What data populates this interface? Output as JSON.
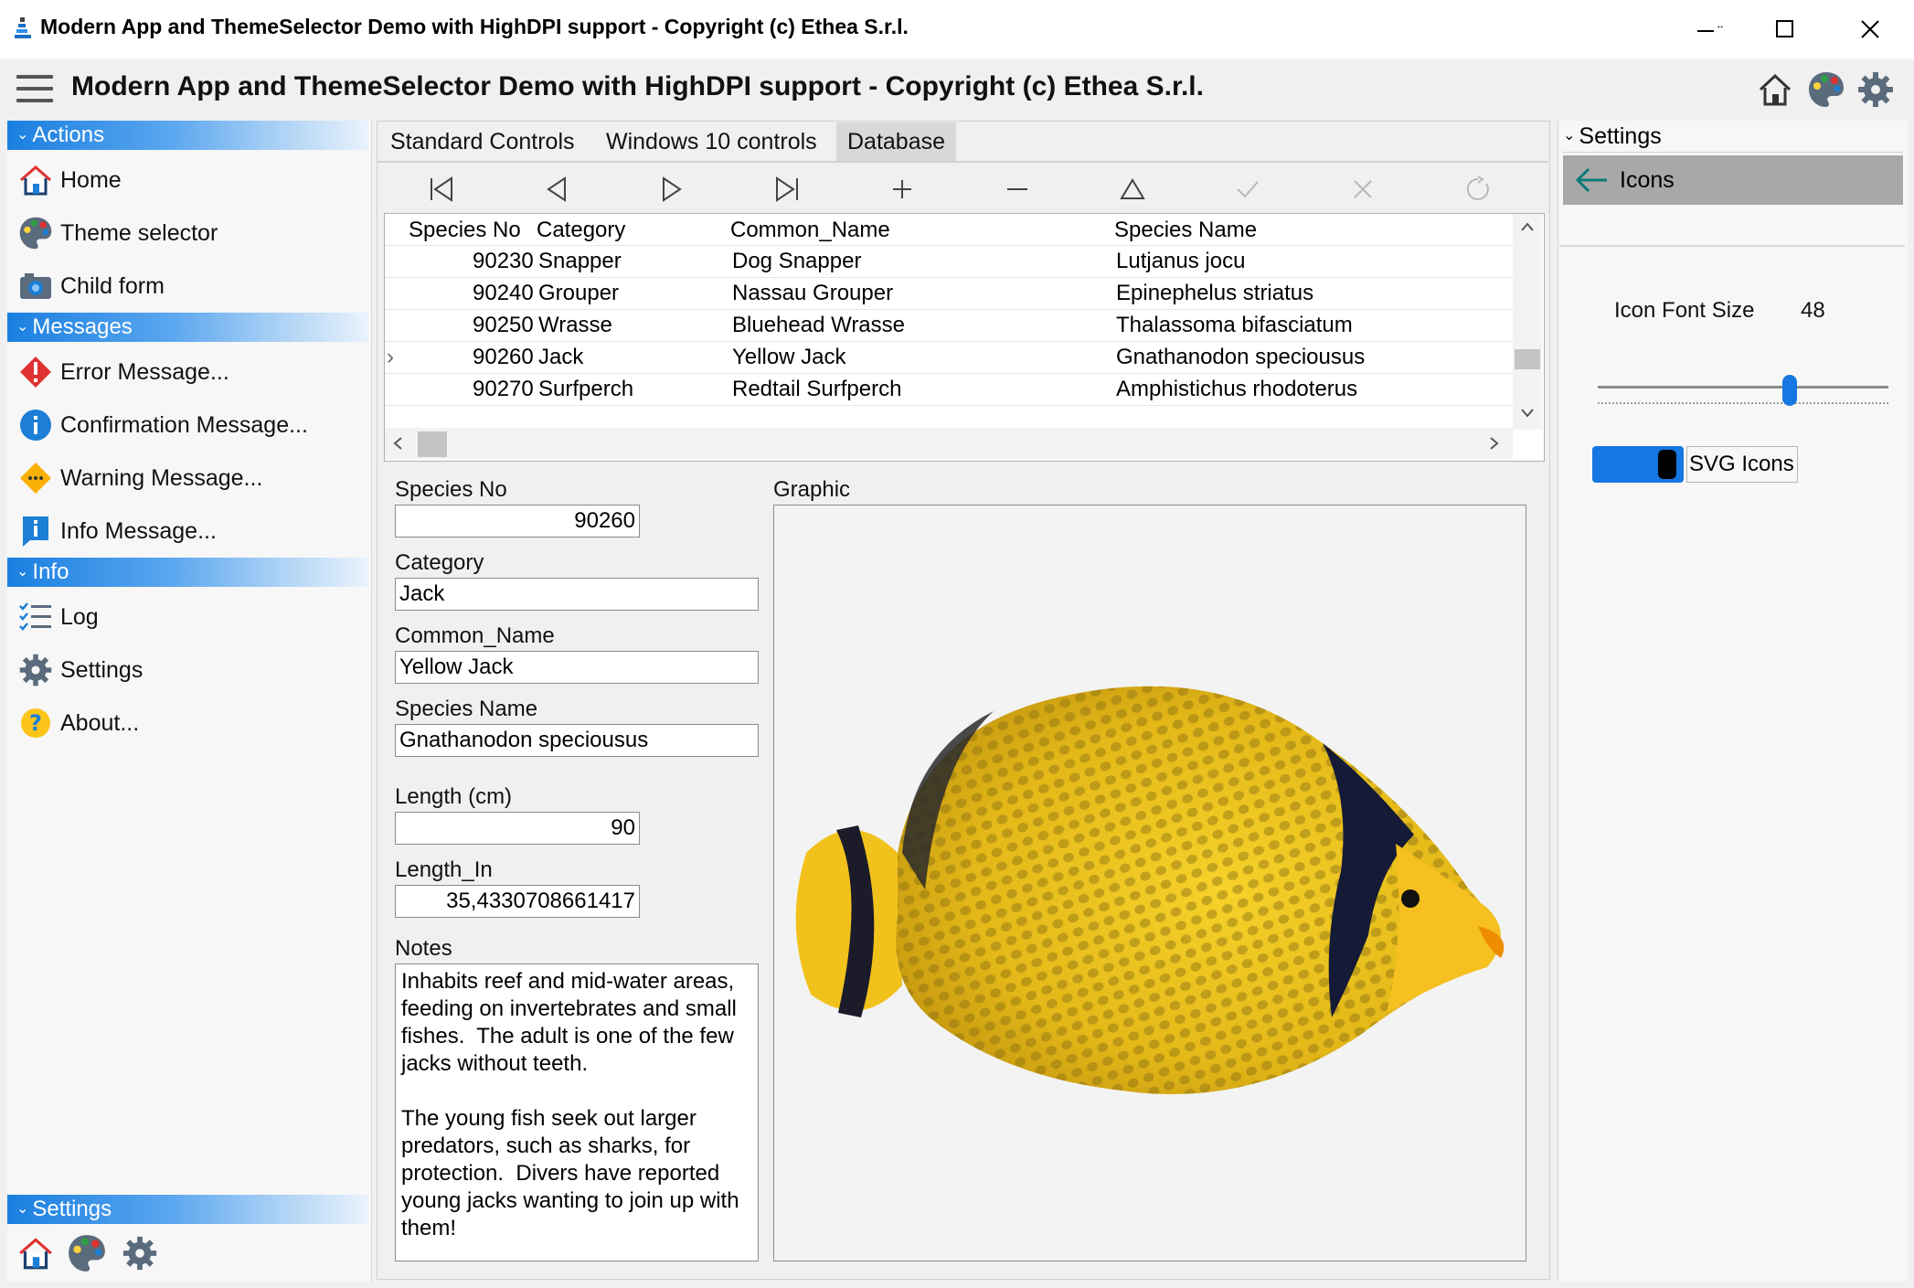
{
  "window": {
    "title": "Modern App and ThemeSelector Demo with HighDPI support - Copyright (c) Ethea S.r.l.",
    "controls": {
      "minimize": "—",
      "maximize": "☐",
      "close": "✕"
    }
  },
  "header": {
    "title": "Modern App and ThemeSelector Demo with HighDPI support - Copyright (c) Ethea S.r.l.",
    "icons": [
      "home-icon",
      "palette-icon",
      "gear-icon"
    ]
  },
  "left_panel": {
    "groups": [
      {
        "title": "Actions",
        "items": [
          {
            "label": "Home",
            "icon": "home-icon"
          },
          {
            "label": "Theme selector",
            "icon": "palette-icon"
          },
          {
            "label": "Child form",
            "icon": "camera-icon"
          }
        ]
      },
      {
        "title": "Messages",
        "items": [
          {
            "label": "Error Message...",
            "icon": "error-icon"
          },
          {
            "label": "Confirmation Message...",
            "icon": "info-circle-icon"
          },
          {
            "label": "Warning Message...",
            "icon": "warning-icon"
          },
          {
            "label": "Info Message...",
            "icon": "info-bubble-icon"
          }
        ]
      },
      {
        "title": "Info",
        "items": [
          {
            "label": "Log",
            "icon": "checklist-icon"
          },
          {
            "label": "Settings",
            "icon": "gear-icon"
          },
          {
            "label": "About...",
            "icon": "question-icon"
          }
        ]
      },
      {
        "title": "Settings",
        "items": []
      }
    ],
    "bottom_icons": [
      "home-icon",
      "palette-icon",
      "gear-icon"
    ]
  },
  "tabs": [
    {
      "label": "Standard Controls",
      "active": false
    },
    {
      "label": "Windows 10 controls",
      "active": false
    },
    {
      "label": "Database",
      "active": true
    }
  ],
  "navigator": {
    "buttons": [
      {
        "name": "first",
        "glyph": "|◁"
      },
      {
        "name": "prior",
        "glyph": "◁"
      },
      {
        "name": "next",
        "glyph": "▷"
      },
      {
        "name": "last",
        "glyph": "▷|"
      },
      {
        "name": "insert",
        "glyph": "+"
      },
      {
        "name": "delete",
        "glyph": "—"
      },
      {
        "name": "edit",
        "glyph": "△"
      },
      {
        "name": "post",
        "glyph": "✓"
      },
      {
        "name": "cancel",
        "glyph": "✕"
      },
      {
        "name": "refresh",
        "glyph": "↻"
      }
    ]
  },
  "grid": {
    "columns": [
      "Species No",
      "Category",
      "Common_Name",
      "Species Name"
    ],
    "rows": [
      {
        "species_no": "90230",
        "category": "Snapper",
        "common_name": "Dog Snapper",
        "species_name": "Lutjanus jocu",
        "current": false
      },
      {
        "species_no": "90240",
        "category": "Grouper",
        "common_name": "Nassau Grouper",
        "species_name": "Epinephelus striatus",
        "current": false
      },
      {
        "species_no": "90250",
        "category": "Wrasse",
        "common_name": "Bluehead Wrasse",
        "species_name": "Thalassoma bifasciatum",
        "current": false
      },
      {
        "species_no": "90260",
        "category": "Jack",
        "common_name": "Yellow Jack",
        "species_name": "Gnathanodon speciousus",
        "current": true
      },
      {
        "species_no": "90270",
        "category": "Surfperch",
        "common_name": "Redtail Surfperch",
        "species_name": "Amphistichus rhodoterus",
        "current": false
      }
    ]
  },
  "detail": {
    "species_no_label": "Species No",
    "species_no": "90260",
    "category_label": "Category",
    "category": "Jack",
    "common_name_label": "Common_Name",
    "common_name": "Yellow Jack",
    "species_name_label": "Species Name",
    "species_name": "Gnathanodon speciousus",
    "length_cm_label": "Length (cm)",
    "length_cm": "90",
    "length_in_label": "Length_In",
    "length_in": "35,4330708661417",
    "notes_label": "Notes",
    "notes": "Inhabits reef and mid-water areas, feeding on invertebrates and small fishes.  The adult is one of the few jacks without teeth.\n\nThe young fish seek out larger predators, such as sharks, for protection.  Divers have reported young jacks wanting to join up with them!",
    "graphic_label": "Graphic"
  },
  "right_panel": {
    "header": "Settings",
    "back_button": "Icons",
    "icon_font_size_label": "Icon Font Size",
    "icon_font_size": "48",
    "slider_fraction": 0.67,
    "toggle_label": "SVG Icons",
    "toggle_on": true
  },
  "colors": {
    "accent": "#1677e2",
    "group_header": "#1a7fe0",
    "selected_tab": "#d8d8d8",
    "icons_button": "#a8a8a8"
  }
}
